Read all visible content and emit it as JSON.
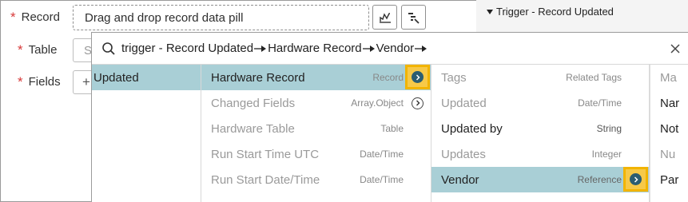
{
  "form": {
    "record_label": "Record",
    "record_pill": "Drag and drop record data pill",
    "table_label": "Table",
    "table_value": "Se",
    "fields_label": "Fields",
    "fields_value": "+"
  },
  "right_panel": {
    "title": "Trigger - Record Updated"
  },
  "picker": {
    "path": [
      "trigger - Record Updated",
      "Hardware Record",
      "Vendor"
    ],
    "column1": [
      {
        "name": "Updated"
      }
    ],
    "column2": [
      {
        "name": "Hardware Record",
        "type": "Record"
      },
      {
        "name": "Changed Fields",
        "type": "Array.Object"
      },
      {
        "name": "Hardware Table",
        "type": "Table"
      },
      {
        "name": "Run Start Time UTC",
        "type": "Date/Time"
      },
      {
        "name": "Run Start Date/Time",
        "type": "Date/Time"
      }
    ],
    "column3": [
      {
        "name": "Tags",
        "type": "Related Tags"
      },
      {
        "name": "Updated",
        "type": "Date/Time"
      },
      {
        "name": "Updated by",
        "type": "String"
      },
      {
        "name": "Updates",
        "type": "Integer"
      },
      {
        "name": "Vendor",
        "type": "Reference"
      }
    ],
    "column4": [
      {
        "name": "Ma"
      },
      {
        "name": "Nar"
      },
      {
        "name": "Not"
      },
      {
        "name": "Nu"
      },
      {
        "name": "Par"
      }
    ]
  },
  "colors": {
    "selected_row": "#a9cfd6",
    "highlight": "#f2b400",
    "nav_circle": "#2b5d71",
    "required": "#d73a3a"
  },
  "icons": [
    "data-pill-icon",
    "tree-picker-icon",
    "search-icon",
    "close-icon",
    "chevron-right-icon"
  ]
}
